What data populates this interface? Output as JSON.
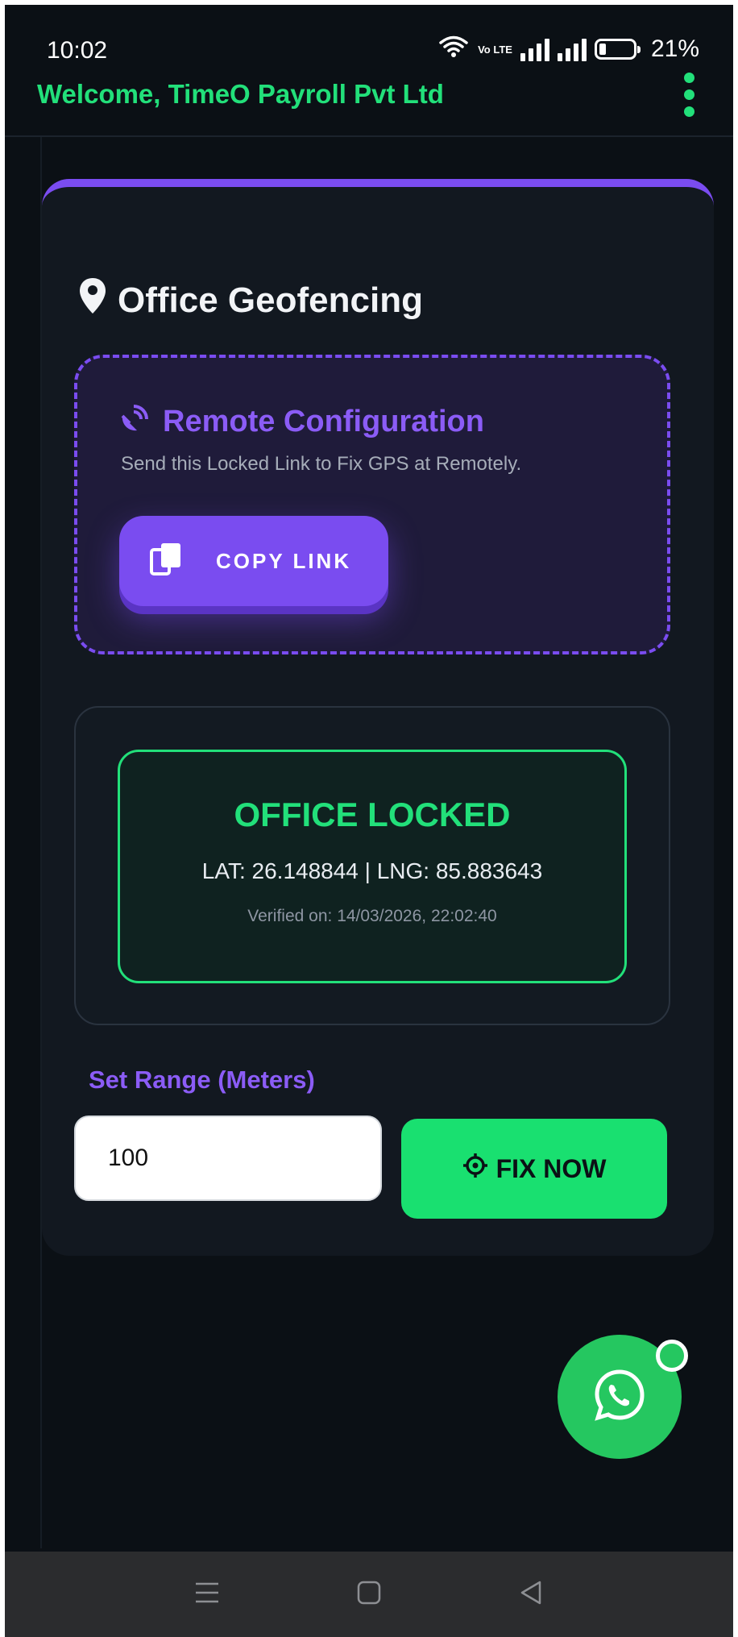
{
  "status_bar": {
    "time": "10:02",
    "battery": "21%",
    "volte": "Vo LTE"
  },
  "header": {
    "welcome": "Welcome, TimeO Payroll Pvt Ltd"
  },
  "card": {
    "title": "Office Geofencing",
    "remote": {
      "title": "Remote Configuration",
      "subtitle": "Send this Locked Link to Fix GPS at Remotely.",
      "copy_label": "COPY LINK"
    },
    "lock_status": {
      "title": "OFFICE LOCKED",
      "coordinates": "LAT: 26.148844 | LNG: 85.883643",
      "verified": "Verified on: 14/03/2026, 22:02:40"
    },
    "range": {
      "label": "Set Range (Meters)",
      "value": "100"
    },
    "fix_label": "FIX NOW"
  },
  "colors": {
    "accent_green": "#22e07a",
    "accent_purple": "#7a4cf0",
    "background": "#0b1015",
    "whatsapp": "#25c760"
  },
  "icons": {
    "title": "location-pin-icon",
    "remote": "satellite-dish-icon",
    "copy": "copy-icon",
    "fix": "crosshair-icon",
    "fab": "whatsapp-icon"
  }
}
